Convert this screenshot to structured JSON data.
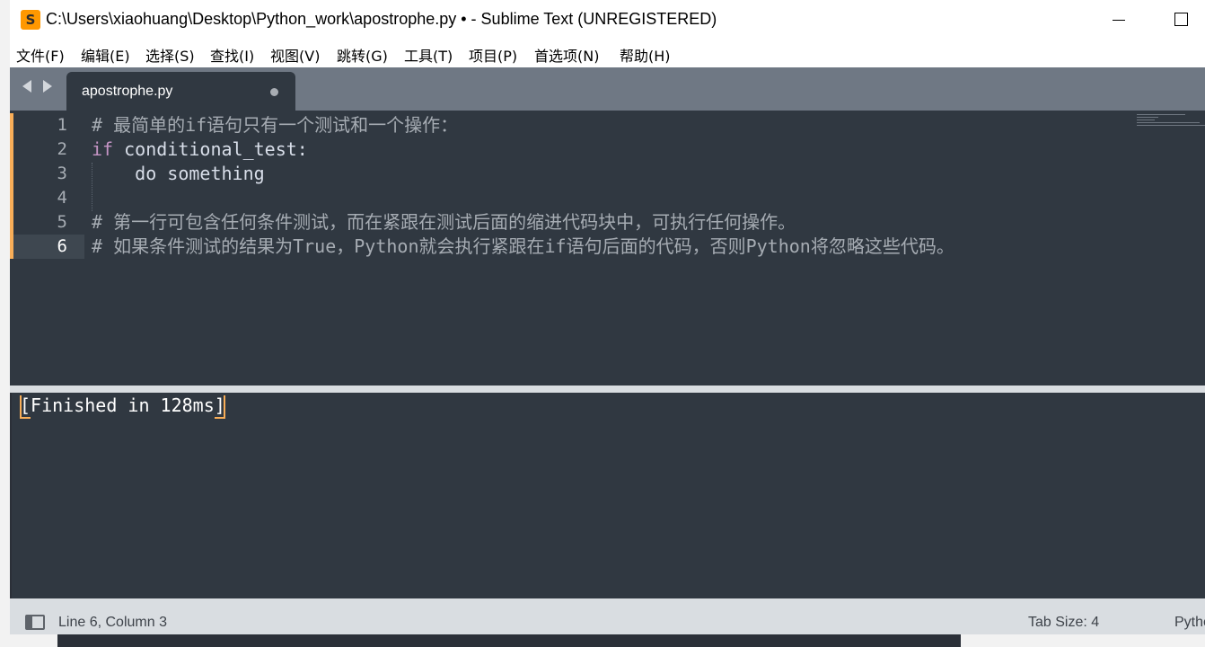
{
  "window": {
    "title": "C:\\Users\\xiaohuang\\Desktop\\Python_work\\apostrophe.py • - Sublime Text (UNREGISTERED)",
    "app_icon_glyph": "S"
  },
  "menu": [
    {
      "label": "文件(F)"
    },
    {
      "label": "编辑(E)"
    },
    {
      "label": "选择(S)"
    },
    {
      "label": "查找(I)"
    },
    {
      "label": "视图(V)"
    },
    {
      "label": "跳转(G)"
    },
    {
      "label": "工具(T)"
    },
    {
      "label": "项目(P)"
    },
    {
      "label": "首选项(N)"
    },
    {
      "label": "帮助(H)"
    }
  ],
  "tabs": [
    {
      "label": "apostrophe.py",
      "modified": true
    }
  ],
  "editor": {
    "lines": [
      {
        "num": "1",
        "tokens": [
          {
            "t": "comment",
            "v": "# 最简单的if语句只有一个测试和一个操作："
          }
        ]
      },
      {
        "num": "2",
        "tokens": [
          {
            "t": "kw",
            "v": "if"
          },
          {
            "t": "plain",
            "v": " conditional_test:"
          }
        ]
      },
      {
        "num": "3",
        "tokens": [
          {
            "t": "plain",
            "v": "    do something"
          }
        ]
      },
      {
        "num": "4",
        "tokens": []
      },
      {
        "num": "5",
        "tokens": [
          {
            "t": "comment",
            "v": "# 第一行可包含任何条件测试，而在紧跟在测试后面的缩进代码块中，可执行任何操作。"
          }
        ]
      },
      {
        "num": "6",
        "tokens": [
          {
            "t": "comment",
            "v": "# 如果条件测试的结果为True，Python就会执行紧跟在if语句后面的代码，否则Python将忽略这些代码。"
          }
        ]
      }
    ],
    "active_line": "6"
  },
  "output": {
    "open": "[",
    "text": "Finished in 128ms",
    "close": "]"
  },
  "status": {
    "position": "Line 6, Column 3",
    "tab_size": "Tab Size: 4",
    "syntax": "Python"
  },
  "colors": {
    "accent": "#f9ae58",
    "editor_bg": "#303841",
    "keyword": "#c594c5",
    "comment": "#a6acb3"
  }
}
